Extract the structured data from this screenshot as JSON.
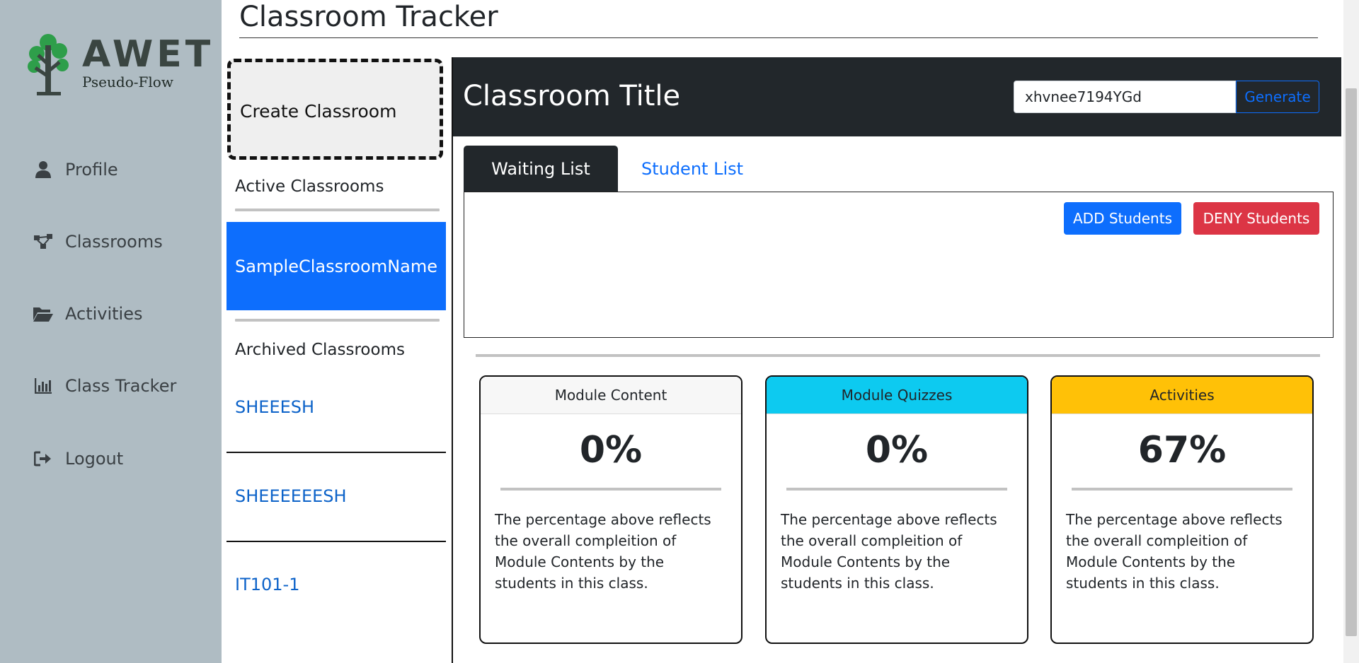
{
  "app": {
    "logo_text": "AWET",
    "logo_subtitle": "Pseudo-Flow"
  },
  "sidebar": {
    "items": [
      {
        "label": "Profile",
        "icon": "user-icon"
      },
      {
        "label": "Classrooms",
        "icon": "share-nodes-icon"
      },
      {
        "label": "Activities",
        "icon": "folder-open-icon"
      },
      {
        "label": "Class Tracker",
        "icon": "chart-bar-icon"
      },
      {
        "label": "Logout",
        "icon": "sign-out-icon"
      }
    ]
  },
  "page": {
    "title": "Classroom Tracker"
  },
  "classrooms": {
    "create_label": "Create Classroom",
    "active_label": "Active Classrooms",
    "active_item": "SampleClassroomName",
    "archived_label": "Archived Classrooms",
    "archived_items": [
      "SHEEESH",
      "SHEEEEEESH",
      "IT101-1"
    ]
  },
  "panel": {
    "title": "Classroom Title",
    "code_value": "xhvnee7194YGd",
    "generate_label": "Generate",
    "tabs": [
      {
        "label": "Waiting List",
        "active": true
      },
      {
        "label": "Student List",
        "active": false
      }
    ],
    "add_label": "ADD Students",
    "deny_label": "DENY Students"
  },
  "cards": [
    {
      "title": "Module Content",
      "value": "0%",
      "description": "The percentage above reflects the overall compleition of Module Contents by the students in this class.",
      "header_color": "#f7f7f7"
    },
    {
      "title": "Module Quizzes",
      "value": "0%",
      "description": "The percentage above reflects the overall compleition of Module Contents by the students in this class.",
      "header_color": "#0dcaf0"
    },
    {
      "title": "Activities",
      "value": "67%",
      "description": "The percentage above reflects the overall compleition of Module Contents by the students in this class.",
      "header_color": "#ffc107"
    }
  ],
  "colors": {
    "sidebar_bg": "#afbcc3",
    "primary": "#0d6efd",
    "danger": "#dc3545",
    "dark": "#22272b"
  }
}
